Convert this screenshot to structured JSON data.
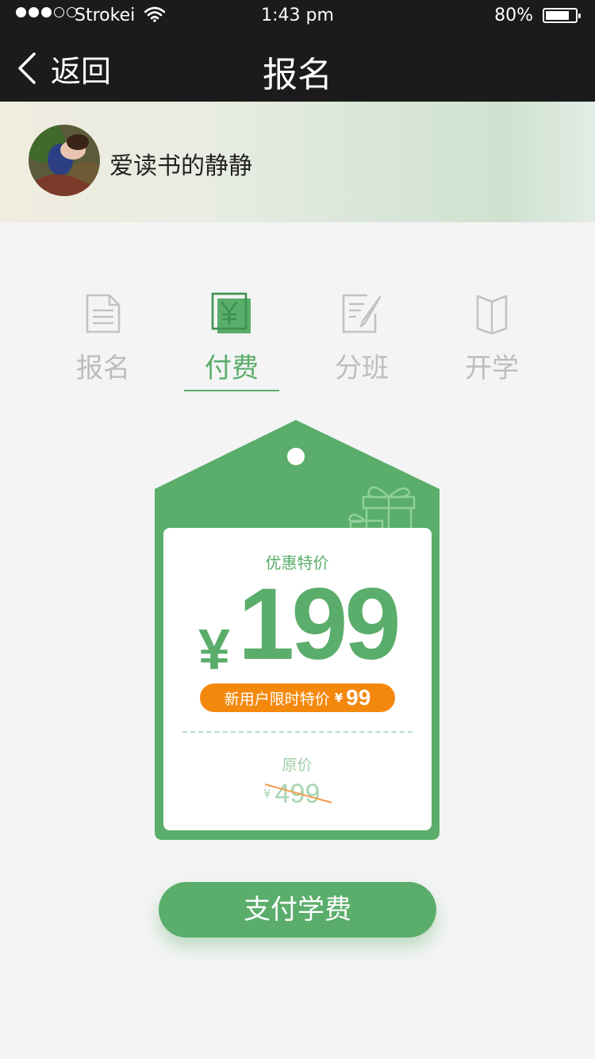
{
  "status_bar": {
    "carrier": "Strokei",
    "time": "1:43 pm",
    "battery": "80%",
    "battery_level": 0.8
  },
  "nav": {
    "back_label": "返回",
    "title": "报名"
  },
  "profile": {
    "username": "爱读书的静静"
  },
  "steps": [
    {
      "label": "报名",
      "icon": "document-icon",
      "active": false
    },
    {
      "label": "付费",
      "icon": "yen-icon",
      "active": true
    },
    {
      "label": "分班",
      "icon": "edit-icon",
      "active": false
    },
    {
      "label": "开学",
      "icon": "book-icon",
      "active": false
    }
  ],
  "price_card": {
    "promo_label": "优惠特价",
    "currency": "¥",
    "price": "199",
    "new_user_text": "新用户限时特价",
    "new_user_currency": "¥",
    "new_user_price": "99",
    "original_label": "原价",
    "original_currency": "¥",
    "original_price": "499"
  },
  "pay_button": "支付学费",
  "colors": {
    "accent": "#5aad6a",
    "promo": "#f4880d",
    "topbar": "#1b1b1b"
  }
}
